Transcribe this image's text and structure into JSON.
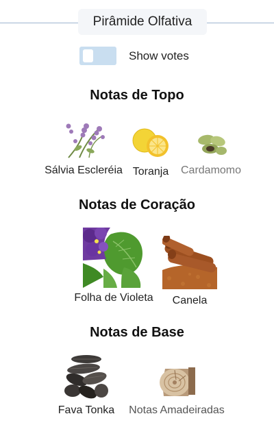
{
  "header": {
    "title": "Pirâmide Olfativa"
  },
  "votes_toggle": {
    "label": "Show votes",
    "on": false
  },
  "sections": [
    {
      "title": "Notas de Topo",
      "notes": [
        {
          "label": "Sálvia Escleréia",
          "icon": "clary-sage-image"
        },
        {
          "label": "Toranja",
          "icon": "grapefruit-image"
        },
        {
          "label": "Cardamomo",
          "icon": "cardamom-image"
        }
      ]
    },
    {
      "title": "Notas de Coração",
      "notes": [
        {
          "label": "Folha de Violeta",
          "icon": "violet-leaf-image"
        },
        {
          "label": "Canela",
          "icon": "cinnamon-image"
        }
      ]
    },
    {
      "title": "Notas de Base",
      "notes": [
        {
          "label": "Fava Tonka",
          "icon": "tonka-bean-image"
        },
        {
          "label": "Notas Amadeiradas",
          "icon": "woody-notes-image"
        }
      ]
    }
  ]
}
